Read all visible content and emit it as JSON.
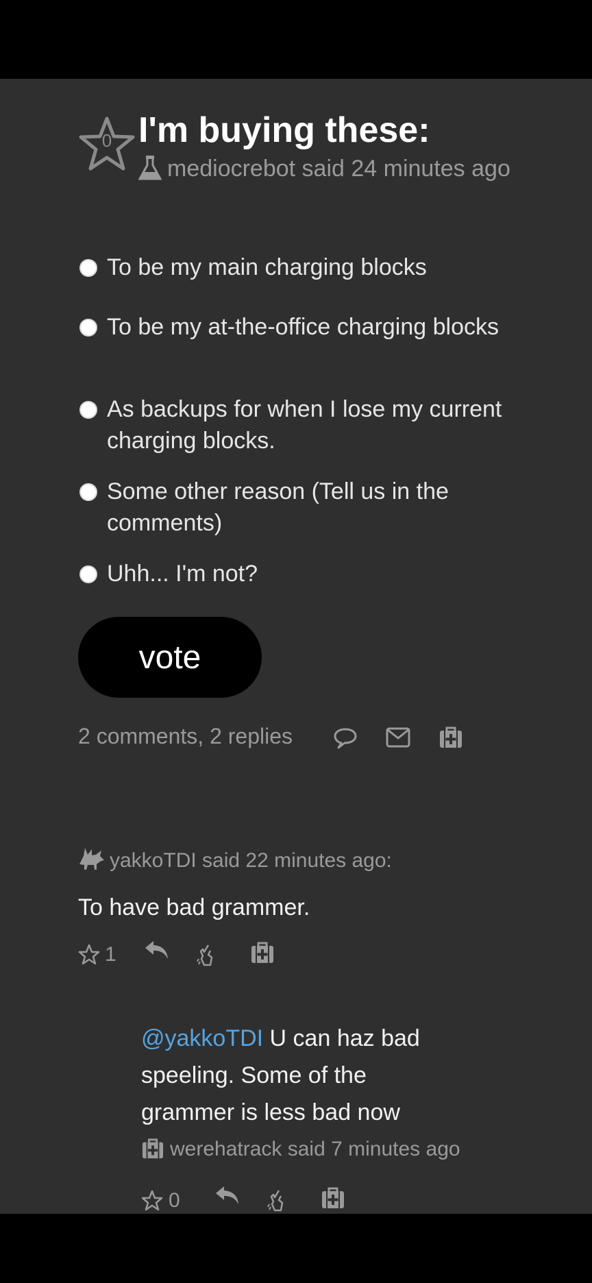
{
  "poll": {
    "title": "I'm buying these:",
    "star_count": "0",
    "author": "mediocrebot",
    "byline": "mediocrebot said 24 minutes ago",
    "options": [
      "To be my main charging blocks",
      "To be my at-the-office charging blocks",
      "As backups for when I lose my current charging blocks.",
      "Some other reason (Tell us in the comments)",
      "Uhh... I'm not?"
    ],
    "vote_label": "vote",
    "comments_summary": "2 comments, 2 replies"
  },
  "comments": [
    {
      "header": "yakkoTDI said 22 minutes ago:",
      "text": "To have bad grammer.",
      "stars": "1"
    }
  ],
  "replies": [
    {
      "mention": "@yakkoTDI",
      "text": " U can haz bad speeling. Some of the grammer is less bad now",
      "header": "werehatrack said 7 minutes ago",
      "stars": "0"
    }
  ],
  "colors": {
    "background": "#2f2f2f",
    "status_bar": "#000000",
    "mention": "#56a3e0",
    "muted_text": "#9a9a9a"
  },
  "icons": {
    "post_star": "star-icon",
    "author": "flask-icon",
    "comment": "speech-bubble-icon",
    "email": "envelope-icon",
    "medkit": "medkit-icon",
    "commenter_avatar": "moose-icon",
    "reply": "reply-arrow-icon",
    "snap": "snap-fingers-icon"
  }
}
